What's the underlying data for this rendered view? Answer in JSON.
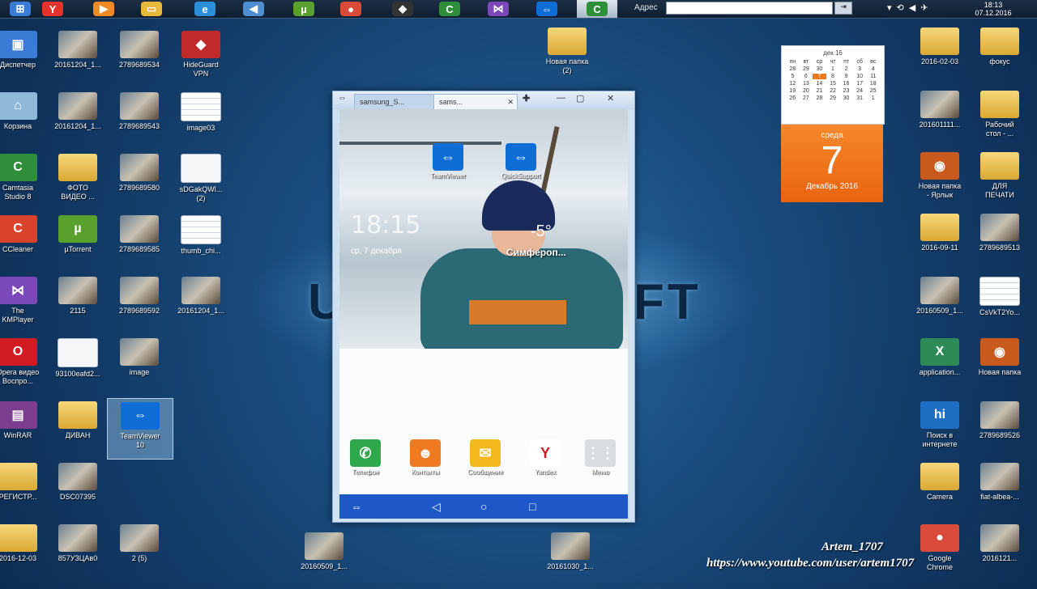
{
  "taskbar": {
    "buttons": [
      {
        "icon": "windows-orb-icon",
        "glyph": "⊞",
        "color": "#3a7bd5"
      },
      {
        "icon": "yandex-browser-icon",
        "glyph": "Y",
        "color": "#e5322d"
      },
      {
        "icon": "media-icon",
        "glyph": "▶",
        "color": "#f08a24"
      },
      {
        "icon": "folder-icon",
        "glyph": "▭",
        "color": "#e8b83b"
      },
      {
        "icon": "internet-explorer-icon",
        "glyph": "e",
        "color": "#2a8fd8"
      },
      {
        "icon": "speaker-icon",
        "glyph": "◀",
        "color": "#4d8fd1"
      },
      {
        "icon": "utorrent-icon",
        "glyph": "µ",
        "color": "#5aa02c"
      },
      {
        "icon": "chrome-icon",
        "glyph": "●",
        "color": "#d94a3a"
      },
      {
        "icon": "hideguard-icon",
        "glyph": "◆",
        "color": "#333333"
      },
      {
        "icon": "camtasia-icon",
        "glyph": "C",
        "color": "#2f8e3a"
      },
      {
        "icon": "player-icon",
        "glyph": "⋈",
        "color": "#7a48b8"
      },
      {
        "icon": "teamviewer-icon",
        "glyph": "⇔",
        "color": "#0e6ed6"
      },
      {
        "icon": "camtasia-recorder-icon",
        "glyph": "C",
        "color": "#2f8e3a"
      }
    ],
    "address_label": "Адрес",
    "address_value": "",
    "clock_time": "18:13",
    "clock_date": "07.12.2016"
  },
  "background_brand": {
    "left": "U",
    "right": "FT"
  },
  "desktop_icons": [
    {
      "label": "Диспетчер",
      "kind": "app",
      "color": "#3a7bd5",
      "glyph": "▣"
    },
    {
      "label": "20161204_1...",
      "kind": "photo"
    },
    {
      "label": "2789689534",
      "kind": "photo"
    },
    {
      "label": "HideGuard\nVPN",
      "kind": "app",
      "color": "#c12a2a",
      "glyph": "◆"
    },
    {
      "label": "Корзина",
      "kind": "app",
      "color": "#8fb8d9",
      "glyph": "⌂"
    },
    {
      "label": "20161204_1...",
      "kind": "photo"
    },
    {
      "label": "2789689543",
      "kind": "photo"
    },
    {
      "label": "image03",
      "kind": "sheet"
    },
    {
      "label": "Camtasia\nStudio 8",
      "kind": "app",
      "color": "#2f8e3a",
      "glyph": "C"
    },
    {
      "label": "ФОТО\nВИДЕО ...",
      "kind": "folder"
    },
    {
      "label": "2789689580",
      "kind": "photo"
    },
    {
      "label": "sDGakQWl...\n(2)",
      "kind": "doc"
    },
    {
      "label": "CCleaner",
      "kind": "app",
      "color": "#d9422b",
      "glyph": "C"
    },
    {
      "label": "µTorrent",
      "kind": "app",
      "color": "#5aa02c",
      "glyph": "µ"
    },
    {
      "label": "2789689585",
      "kind": "photo"
    },
    {
      "label": "thumb_chi...",
      "kind": "sheet"
    },
    {
      "label": "The\nKMPlayer",
      "kind": "app",
      "color": "#7a48b8",
      "glyph": "⋈"
    },
    {
      "label": "2115",
      "kind": "photo"
    },
    {
      "label": "2789689592",
      "kind": "photo"
    },
    {
      "label": "20161204_1...",
      "kind": "photo"
    },
    {
      "label": "Opera видео\nВоспро...",
      "kind": "app",
      "color": "#d11b20",
      "glyph": "O"
    },
    {
      "label": "93100eafd2...",
      "kind": "doc"
    },
    {
      "label": "image",
      "kind": "photo"
    },
    {
      "label": "WinRAR",
      "kind": "app",
      "color": "#7b3e8f",
      "glyph": "▤"
    },
    {
      "label": "ДИВАН",
      "kind": "folder"
    },
    {
      "label": "TeamViewer\n10",
      "kind": "app",
      "color": "#0e6ed6",
      "glyph": "⇔"
    },
    {
      "label": "РЕГИСТР...",
      "kind": "folder"
    },
    {
      "label": "DSC07395",
      "kind": "photo"
    },
    {
      "label": "2016-12-03",
      "kind": "folder"
    },
    {
      "label": "857УЗЦАв0",
      "kind": "photo"
    },
    {
      "label": "2 (5)",
      "kind": "photo"
    },
    {
      "label": "Новая папка\n(2)",
      "kind": "folder"
    },
    {
      "label": "20160509_1...",
      "kind": "photo"
    },
    {
      "label": "20161030_1...",
      "kind": "photo"
    },
    {
      "label": "2016-02-03",
      "kind": "folder"
    },
    {
      "label": "фокус",
      "kind": "folder"
    },
    {
      "label": "201601111...",
      "kind": "photo"
    },
    {
      "label": "Рабочий\nстол - ...",
      "kind": "folder"
    },
    {
      "label": "Новая папка\n- Ярлык",
      "kind": "app",
      "color": "#c85a1e",
      "glyph": "◉"
    },
    {
      "label": "ДЛЯ\nПЕЧАТИ",
      "kind": "folder"
    },
    {
      "label": "2016-09-11",
      "kind": "folder"
    },
    {
      "label": "2789689513",
      "kind": "photo"
    },
    {
      "label": "20160509_1...",
      "kind": "photo"
    },
    {
      "label": "CsVkT2Yo...",
      "kind": "sheet"
    },
    {
      "label": "application...",
      "kind": "app",
      "color": "#2e8b57",
      "glyph": "X"
    },
    {
      "label": "Новая папка",
      "kind": "app",
      "color": "#c85a1e",
      "glyph": "◉"
    },
    {
      "label": "Поиск в\nинтернете",
      "kind": "app",
      "color": "#1e6fc4",
      "glyph": "hi"
    },
    {
      "label": "2789689526",
      "kind": "photo"
    },
    {
      "label": "Camera",
      "kind": "folder"
    },
    {
      "label": "fiat-albea-...",
      "kind": "photo"
    },
    {
      "label": "Google\nChrome",
      "kind": "app",
      "color": "#d94a3a",
      "glyph": "●"
    },
    {
      "label": "2016121...",
      "kind": "photo"
    }
  ],
  "calendar": {
    "month_header": "дек 16",
    "weekdays": [
      "пн",
      "вт",
      "ср",
      "чт",
      "пт",
      "сб",
      "вс"
    ],
    "days": [
      "28",
      "29",
      "30",
      "1",
      "2",
      "3",
      "4",
      "5",
      "6",
      "7",
      "8",
      "9",
      "10",
      "11",
      "12",
      "13",
      "14",
      "15",
      "16",
      "17",
      "18",
      "19",
      "20",
      "21",
      "22",
      "23",
      "24",
      "25",
      "26",
      "27",
      "28",
      "29",
      "30",
      "31",
      "1"
    ],
    "today_index": 9,
    "weekday_full": "среда",
    "day_number": "7",
    "month_year": "Декабрь 2016"
  },
  "teamviewer_window": {
    "tabs": [
      "samsung_S...",
      "sams..."
    ],
    "phone": {
      "time": "18:15",
      "temperature": "-5°",
      "city": "Симфероп...",
      "date": "ср, 7 декабря",
      "top_widgets": [
        {
          "label": "TeamViewer",
          "icon": "teamviewer-icon",
          "color": "#0e6ed6",
          "glyph": "⇔"
        },
        {
          "label": "QuickSupport",
          "icon": "quicksupport-icon",
          "color": "#0e6ed6",
          "glyph": "⇔"
        }
      ],
      "dock": [
        {
          "label": "Телефон",
          "icon": "phone-icon",
          "color": "#2ea84a",
          "glyph": "✆"
        },
        {
          "label": "Контакты",
          "icon": "contacts-icon",
          "color": "#f07a21",
          "glyph": "☻"
        },
        {
          "label": "Сообщения",
          "icon": "messages-icon",
          "color": "#f2b81c",
          "glyph": "✉"
        },
        {
          "label": "Yandex",
          "icon": "yandex-icon",
          "color": "#ffffff",
          "glyph": "Y"
        },
        {
          "label": "Меню",
          "icon": "apps-menu-icon",
          "color": "#d9dde2",
          "glyph": "⋮⋮"
        }
      ]
    }
  },
  "watermark": {
    "name": "Artem_1707",
    "url": "https://www.youtube.com/user/artem1707"
  }
}
